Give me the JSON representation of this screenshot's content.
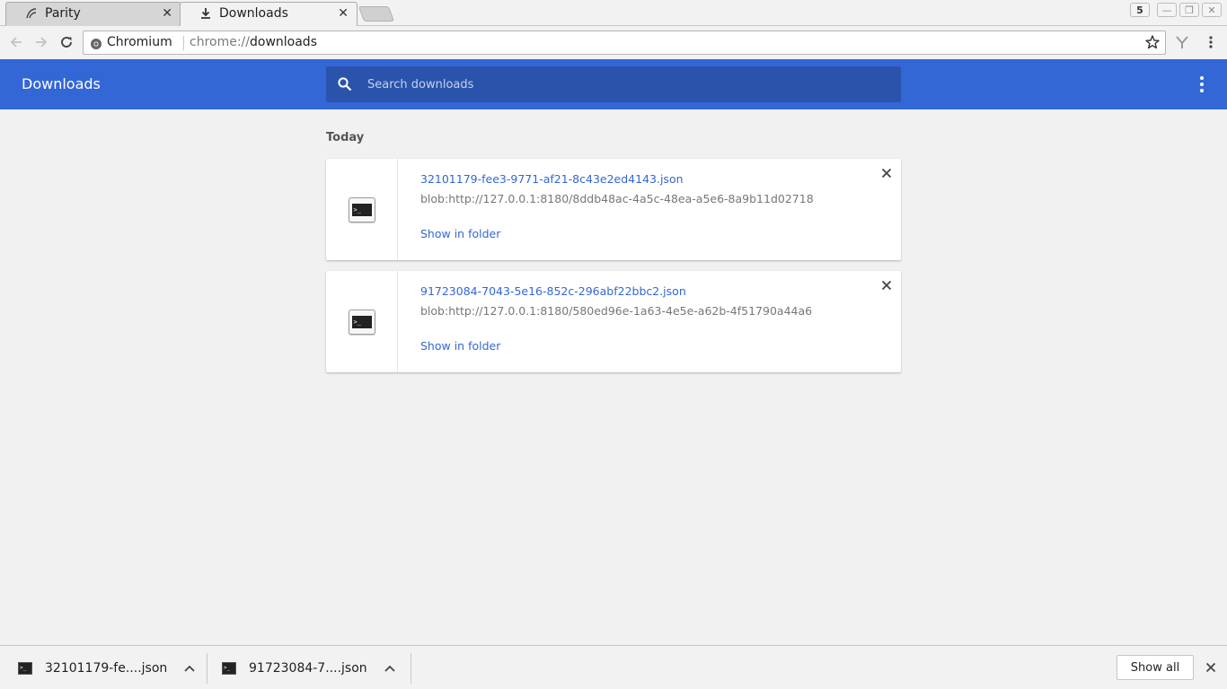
{
  "browser": {
    "tabs": [
      {
        "title": "Parity",
        "icon": "parity-icon",
        "active": false
      },
      {
        "title": "Downloads",
        "icon": "download-icon",
        "active": true
      }
    ],
    "window_badge": "5",
    "omnibox": {
      "site_name": "Chromium",
      "url_scheme": "chrome://",
      "url_path": "downloads"
    }
  },
  "downloads_page": {
    "title": "Downloads",
    "search": {
      "placeholder": "Search downloads"
    },
    "section_label": "Today",
    "items": [
      {
        "filename": "32101179-fee3-9771-af21-8c43e2ed4143.json",
        "url": "blob:http://127.0.0.1:8180/8ddb48ac-4a5c-48ea-a5e6-8a9b11d02718",
        "action": "Show in folder",
        "icon": "terminal-file-icon"
      },
      {
        "filename": "91723084-7043-5e16-852c-296abf22bbc2.json",
        "url": "blob:http://127.0.0.1:8180/580ed96e-1a63-4e5e-a62b-4f51790a44a6",
        "action": "Show in folder",
        "icon": "terminal-file-icon"
      }
    ]
  },
  "shelf": {
    "items": [
      {
        "label": "32101179-fe....json"
      },
      {
        "label": "91723084-7....json"
      }
    ],
    "show_all_label": "Show all"
  },
  "colors": {
    "header_blue": "#3367d6",
    "search_blue": "#2a53ab",
    "link_blue": "#3367d6"
  }
}
